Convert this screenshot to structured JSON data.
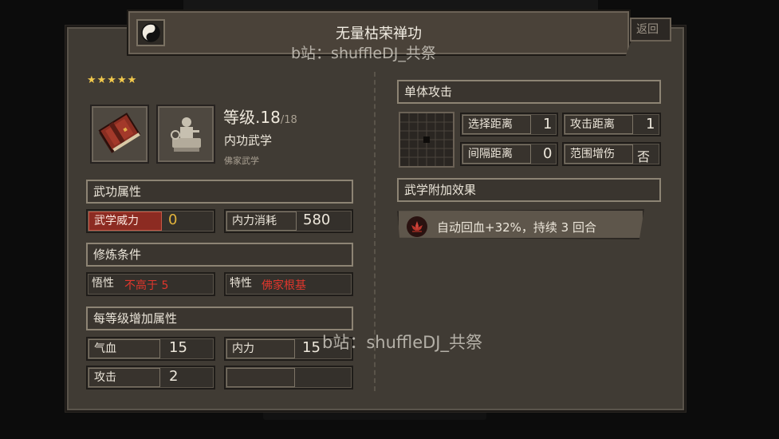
{
  "header": {
    "title": "无量枯荣禅功",
    "back_label": "返回"
  },
  "watermark": {
    "text": "b站：shuffleDJ_共祭"
  },
  "skill": {
    "stars": "★★★★★",
    "level_label": "等级",
    "level_value": ".18",
    "level_max": "/18",
    "type": "内功武学",
    "school": "佛家武学"
  },
  "sections": {
    "attributes": "武功属性",
    "requirements": "修炼条件",
    "per_level": "每等级增加属性",
    "attack_kind": "单体攻击",
    "extra_effects": "武学附加效果"
  },
  "attributes": {
    "power_label": "武学威力",
    "power_value": "0",
    "mp_label": "内力消耗",
    "mp_value": "580"
  },
  "requirements": {
    "wisdom_label": "悟性",
    "wisdom_value": "不高于 5",
    "trait_label": "特性",
    "trait_value": "佛家根基"
  },
  "per_level": {
    "hp_label": "气血",
    "hp_value": "15",
    "mp_label": "内力",
    "mp_value": "15",
    "atk_label": "攻击",
    "atk_value": "2"
  },
  "range": {
    "select_label": "选择距离",
    "select_value": "1",
    "attack_label": "攻击距离",
    "attack_value": "1",
    "gap_label": "间隔距离",
    "gap_value": "0",
    "aoe_label": "范围增伤",
    "aoe_value": "否"
  },
  "effect": {
    "text": "自动回血+32%，持续 3 回合"
  },
  "colors": {
    "accent_red": "#8c2b22",
    "gold": "#e2b33b",
    "warn_red": "#e0362c"
  },
  "icons": [
    "yin-yang-icon",
    "book-icon",
    "meditating-monk-icon",
    "lotus-icon"
  ]
}
